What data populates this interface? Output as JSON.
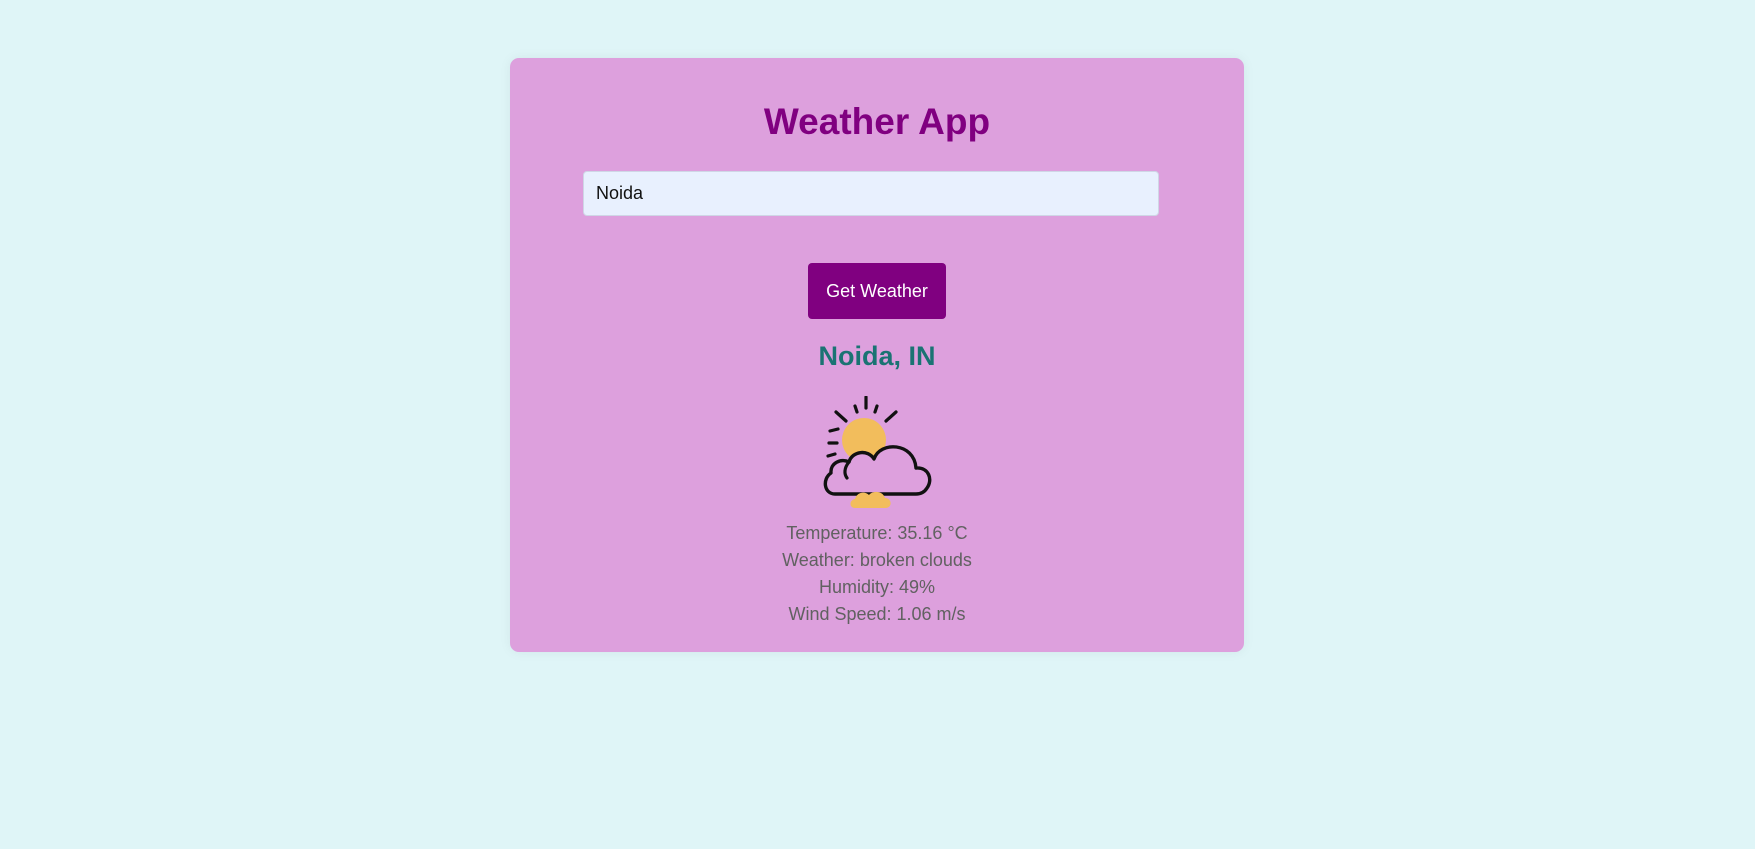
{
  "app": {
    "title": "Weather App"
  },
  "search": {
    "value": "Noida"
  },
  "actions": {
    "get_weather_label": "Get Weather"
  },
  "result": {
    "location": "Noida, IN",
    "icon": "sun-behind-cloud-icon",
    "details": {
      "temperature": "Temperature: 35.16 °C",
      "weather": "Weather: broken clouds",
      "humidity": "Humidity: 49%",
      "wind_speed": "Wind Speed: 1.06 m/s"
    }
  },
  "colors": {
    "page_background": "#dff5f7",
    "card_background": "#dda0dd",
    "accent": "#800080",
    "location_text": "#1a7373",
    "detail_text": "#616161",
    "sun": "#f2bd5c"
  }
}
